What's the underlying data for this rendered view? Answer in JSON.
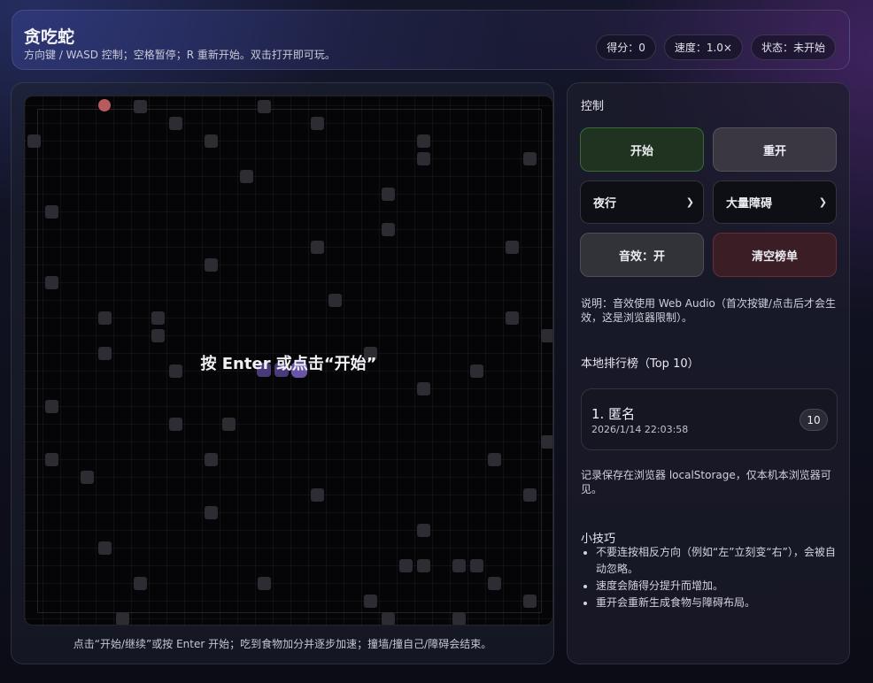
{
  "header": {
    "title": "贪吃蛇",
    "subtitle": "方向键 / WASD 控制；空格暂停；R 重新开始。双击打开即可玩。",
    "score": "得分：0",
    "speed": "速度：1.0×",
    "status": "状态：未开始"
  },
  "board": {
    "overlay": "按 Enter 或点击“开始”",
    "hint": "点击“开始/继续”或按 Enter 开始；吃到食物加分并逐步加速；撞墙/撞自己/障碍会结束。",
    "colors": {
      "obstacle": "#2c2c32",
      "food": "#b85a5e",
      "snake": "#6a54a8"
    }
  },
  "controls": {
    "title": "控制",
    "start_label": "开始",
    "restart_label": "重开",
    "theme_value": "夜行",
    "obstacle_value": "大量障碍",
    "sound_label": "音效：开",
    "clear_label": "清空榜单",
    "note": "说明：音效使用 Web Audio（首次按键/点击后才会生效，这是浏览器限制）。"
  },
  "leaderboard": {
    "title": "本地排行榜（Top 10）",
    "entries": [
      {
        "name": "1. 匿名",
        "time": "2026/1/14 22:03:58",
        "score": "10"
      }
    ],
    "note": "记录保存在浏览器 localStorage，仅本机本浏览器可见。"
  },
  "tips": {
    "title": "小技巧",
    "items": [
      "不要连按相反方向（例如“左”立刻变“右”），会被自动忽略。",
      "速度会随得分提升而增加。",
      "重开会重新生成食物与障碍布局。"
    ]
  }
}
